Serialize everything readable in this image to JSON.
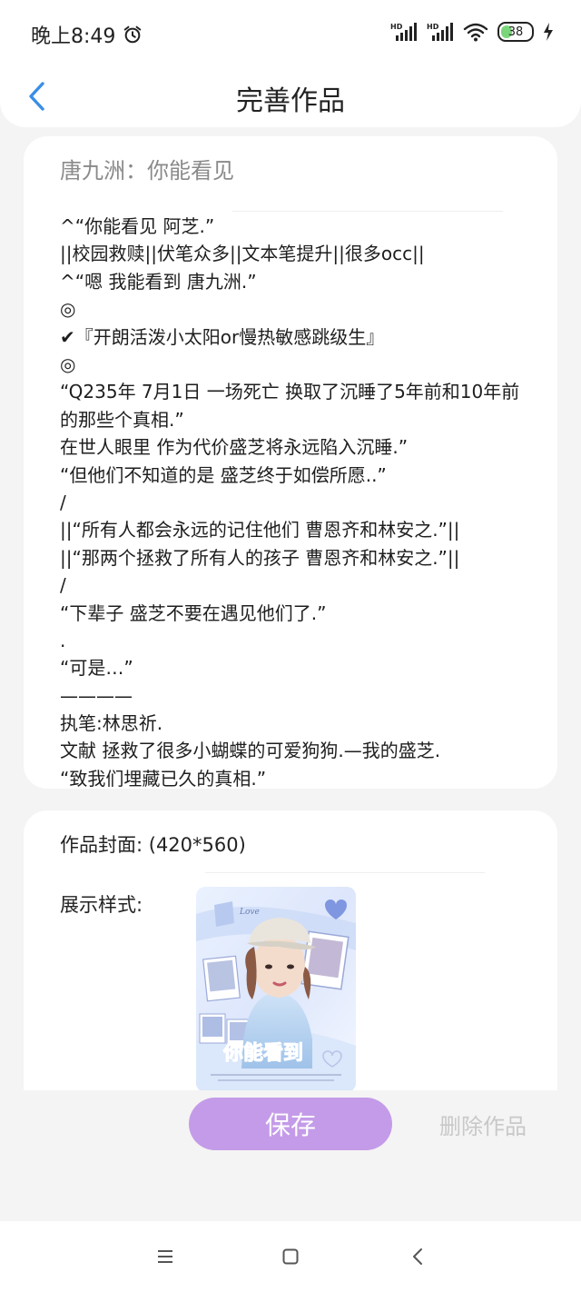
{
  "status_bar": {
    "time": "晚上8:49",
    "battery": "38",
    "battery_level": 0.38,
    "icons": [
      "alarm-icon",
      "hd-signal-icon",
      "hd-signal-icon",
      "wifi-icon",
      "battery-icon",
      "charging-bolt-icon"
    ]
  },
  "header": {
    "back_icon": "chevron-left-icon",
    "title": "完善作品"
  },
  "work": {
    "title": "唐九洲：你能看见",
    "description_lines": [
      "^“你能看见 阿芝.”",
      "||校园救赎||伏笔众多||文本笔提升||很多occ||",
      "^“嗯 我能看到 唐九洲.”",
      "◎",
      "✔『开朗活泼小太阳or慢热敏感跳级生』",
      "◎",
      "“Q235年 7月1日 一场死亡 换取了沉睡了5年前和10年前的那些个真相.”",
      "在世人眼里 作为代价盛芝将永远陷入沉睡.”",
      "“但他们不知道的是 盛芝终于如偿所愿..”",
      "/",
      "||“所有人都会永远的记住他们  曹恩齐和林安之.”||",
      "||“那两个拯救了所有人的孩子  曹恩齐和林安之.”||",
      "/",
      "“下辈子 盛芝不要在遇见他们了.”",
      ".",
      "“可是…”",
      "————",
      "执笔:林思祈.",
      "文献 拯救了很多小蝴蝶的可爱狗狗.—我的盛芝.",
      "“致我们埋藏已久的真相.”"
    ]
  },
  "cover": {
    "label": "作品封面: (420*560)",
    "style_label": "展示样式:",
    "image_text": "你能看到",
    "image_small_text": "Love"
  },
  "footer": {
    "save_label": "保存",
    "delete_label": "删除作品"
  },
  "nav": {
    "icons": [
      "menu-icon",
      "home-square-icon",
      "back-chevron-icon"
    ]
  },
  "colors": {
    "accent": "#c49be8",
    "back_icon": "#3a8ee6",
    "muted_text": "#8a8a8a",
    "delete_text": "#c8c8c8"
  }
}
